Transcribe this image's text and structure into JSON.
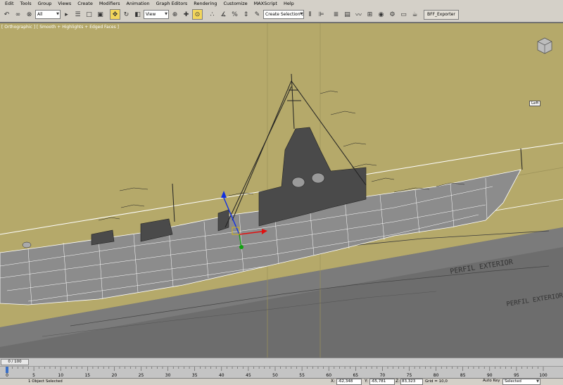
{
  "menu": [
    "Edit",
    "Tools",
    "Group",
    "Views",
    "Create",
    "Modifiers",
    "Animation",
    "Graph Editors",
    "Rendering",
    "Customize",
    "MAXScript",
    "Help"
  ],
  "toolbar": {
    "filter_value": "All",
    "refcoord_value": "View",
    "selection_set_placeholder": "Create Selection Se",
    "exporter_label": "BFF_Exporter"
  },
  "viewport": {
    "label": "[ Orthographic ] [ Smooth + Highlights + Edged Faces ]",
    "view_label": "Left",
    "annotations": [
      "PERFIL EXTERIOR",
      "PERFIL EXTERIOR"
    ]
  },
  "timeslider": {
    "frame_text": "0 / 100"
  },
  "trackbar": {
    "ticks": [
      "0",
      "5",
      "10",
      "15",
      "20",
      "25",
      "30",
      "35",
      "40",
      "45",
      "50",
      "55",
      "60",
      "65",
      "70",
      "75",
      "80",
      "85",
      "90",
      "95",
      "100"
    ]
  },
  "status": {
    "selection_text": "1 Object Selected",
    "x_label": "X:",
    "x_value": "-62,348",
    "y_label": "Y:",
    "y_value": "-65,781",
    "z_label": "Z:",
    "z_value": "83,323",
    "grid_text": "Grid = 10,0",
    "autokey_label": "Auto Key",
    "selected_value": "Selected"
  },
  "colors": {
    "viewport_bg": "#b5a96a",
    "hull_fill": "#8c8c8c",
    "wire_white": "#ffffff",
    "gizmo_red": "#e01010",
    "gizmo_green": "#10a010",
    "gizmo_blue": "#1030e0",
    "active_tool": "#f2d65b"
  }
}
